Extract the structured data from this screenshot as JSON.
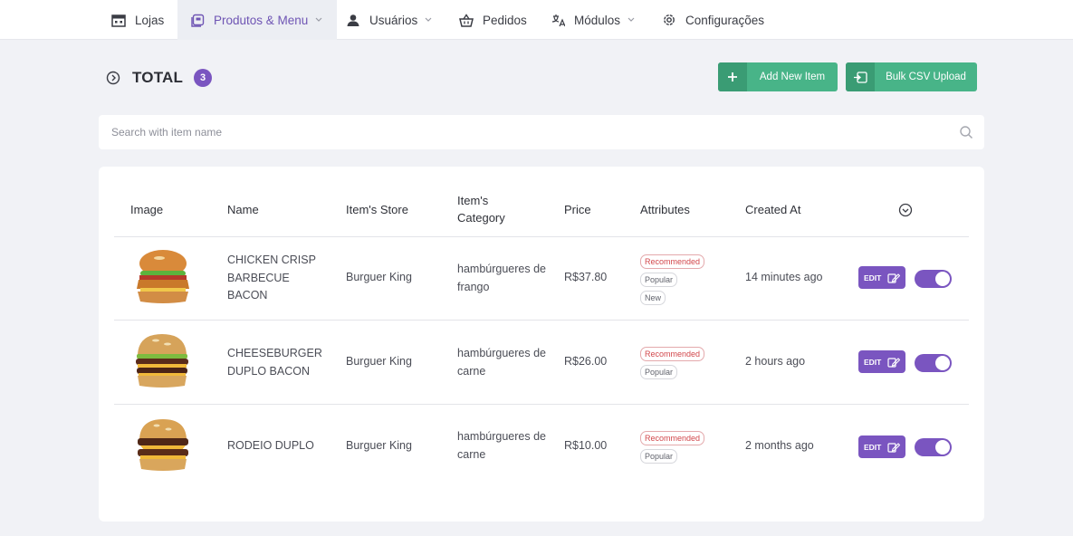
{
  "nav": {
    "items": [
      {
        "label": "Lojas",
        "icon": "store-icon"
      },
      {
        "label": "Produtos & Menu",
        "icon": "menu-card-icon",
        "active": true
      },
      {
        "label": "Usuários",
        "icon": "user-icon"
      },
      {
        "label": "Pedidos",
        "icon": "basket-icon"
      },
      {
        "label": "Módulos",
        "icon": "modules-icon"
      },
      {
        "label": "Configurações",
        "icon": "gear-icon"
      }
    ]
  },
  "header": {
    "total_label": "TOTAL",
    "count": "3",
    "add_button": "Add New Item",
    "csv_button": "Bulk CSV Upload"
  },
  "search": {
    "placeholder": "Search with item name",
    "value": ""
  },
  "table": {
    "columns": [
      "Image",
      "Name",
      "Item's Store",
      "Item's Category",
      "Price",
      "Attributes",
      "Created At"
    ],
    "edit_label": "EDIT",
    "rows": [
      {
        "name": "CHICKEN CRISP BARBECUE BACON",
        "store": "Burguer King",
        "category": "hambúrgueres de frango",
        "price": "R$37.80",
        "attributes": [
          "Recommended",
          "Popular",
          "New"
        ],
        "created": "14 minutes ago",
        "active": true
      },
      {
        "name": "CHEESEBURGER DUPLO BACON",
        "store": "Burguer King",
        "category": "hambúrgueres de carne",
        "price": "R$26.00",
        "attributes": [
          "Recommended",
          "Popular"
        ],
        "created": "2 hours ago",
        "active": true
      },
      {
        "name": "RODEIO DUPLO",
        "store": "Burguer King",
        "category": "hambúrgueres de carne",
        "price": "R$10.00",
        "attributes": [
          "Recommended",
          "Popular"
        ],
        "created": "2 months ago",
        "active": true
      }
    ]
  },
  "colors": {
    "accent": "#7a55c0",
    "green": "#48b488",
    "recommended": "#d2484c"
  }
}
